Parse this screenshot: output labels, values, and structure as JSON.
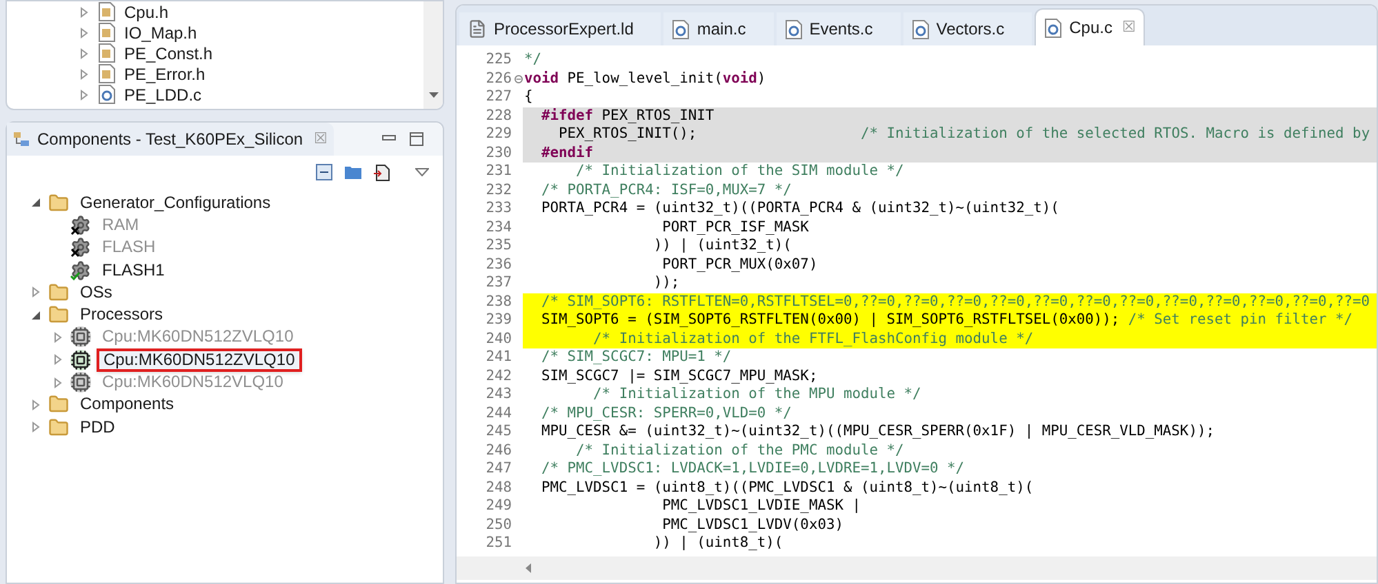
{
  "files": [
    {
      "label": "Cpu.h",
      "kind": "header",
      "expanded": false
    },
    {
      "label": "IO_Map.h",
      "kind": "header",
      "expanded": false
    },
    {
      "label": "PE_Const.h",
      "kind": "header",
      "expanded": false
    },
    {
      "label": "PE_Error.h",
      "kind": "header",
      "expanded": false
    },
    {
      "label": "PE_LDD.c",
      "kind": "source",
      "expanded": false
    }
  ],
  "components_panel": {
    "title": "Components - Test_K60PEx_Silicon",
    "close": "☒",
    "tree": [
      {
        "label": "Generator_Configurations",
        "kind": "folder",
        "expanded": true,
        "children": [
          {
            "label": "RAM",
            "kind": "component",
            "disabled": true,
            "selected": false
          },
          {
            "label": "FLASH",
            "kind": "component",
            "disabled": true,
            "selected": false
          },
          {
            "label": "FLASH1",
            "kind": "component",
            "disabled": false,
            "selected": false
          }
        ]
      },
      {
        "label": "OSs",
        "kind": "folder",
        "expanded": false
      },
      {
        "label": "Processors",
        "kind": "folder",
        "expanded": true,
        "children": [
          {
            "label": "Cpu:MK60DN512ZVLQ10",
            "kind": "cpu",
            "expanded": false,
            "disabled": true,
            "selected": false
          },
          {
            "label": "Cpu:MK60DN512ZVLQ10",
            "kind": "cpu",
            "expanded": false,
            "disabled": false,
            "selected": true
          },
          {
            "label": "Cpu:MK60DN512VLQ10",
            "kind": "cpu",
            "expanded": false,
            "disabled": true,
            "selected": false
          }
        ]
      },
      {
        "label": "Components",
        "kind": "folder",
        "expanded": false
      },
      {
        "label": "PDD",
        "kind": "folder",
        "expanded": false
      }
    ]
  },
  "editor": {
    "tabs": [
      {
        "label": "ProcessorExpert.ld",
        "kind": "text",
        "selected": false
      },
      {
        "label": "main.c",
        "kind": "source",
        "selected": false
      },
      {
        "label": "Events.c",
        "kind": "source",
        "selected": false
      },
      {
        "label": "Vectors.c",
        "kind": "source",
        "selected": false
      },
      {
        "label": "Cpu.c",
        "kind": "source",
        "selected": true
      }
    ],
    "tab_close": "☒",
    "lines": [
      {
        "number": "225",
        "kind": "plain",
        "fold_marker": false,
        "segments": [
          {
            "kind": "comment",
            "text": "*/"
          }
        ]
      },
      {
        "number": "226",
        "kind": "plain",
        "fold_marker": true,
        "segments": [
          {
            "kind": "keyword",
            "text": "void"
          },
          {
            "kind": "code",
            "text": " PE_low_level_init("
          },
          {
            "kind": "keyword",
            "text": "void"
          },
          {
            "kind": "code",
            "text": ")"
          }
        ]
      },
      {
        "number": "227",
        "kind": "plain",
        "fold_marker": false,
        "segments": [
          {
            "kind": "code",
            "text": "{"
          }
        ]
      },
      {
        "number": "228",
        "kind": "inactive",
        "fold_marker": false,
        "segments": [
          {
            "kind": "keyword",
            "text": "  #ifdef"
          },
          {
            "kind": "code",
            "text": " PEX_RTOS_INIT"
          }
        ]
      },
      {
        "number": "229",
        "kind": "inactive",
        "fold_marker": false,
        "segments": [
          {
            "kind": "code",
            "text": "    PEX_RTOS_INIT();                   "
          },
          {
            "kind": "comment",
            "text": "/* Initialization of the selected RTOS. Macro is defined by"
          }
        ]
      },
      {
        "number": "230",
        "kind": "inactive",
        "fold_marker": false,
        "segments": [
          {
            "kind": "keyword",
            "text": "  #endif"
          }
        ]
      },
      {
        "number": "231",
        "kind": "plain",
        "fold_marker": false,
        "segments": [
          {
            "kind": "comment",
            "text": "      /* Initialization of the SIM module */"
          }
        ]
      },
      {
        "number": "232",
        "kind": "plain",
        "fold_marker": false,
        "segments": [
          {
            "kind": "comment",
            "text": "  /* PORTA_PCR4: ISF=0,MUX=7 */"
          }
        ]
      },
      {
        "number": "233",
        "kind": "plain",
        "fold_marker": false,
        "segments": [
          {
            "kind": "code",
            "text": "  PORTA_PCR4 = (uint32_t)((PORTA_PCR4 & (uint32_t)~(uint32_t)("
          }
        ]
      },
      {
        "number": "234",
        "kind": "plain",
        "fold_marker": false,
        "segments": [
          {
            "kind": "code",
            "text": "                PORT_PCR_ISF_MASK"
          }
        ]
      },
      {
        "number": "235",
        "kind": "plain",
        "fold_marker": false,
        "segments": [
          {
            "kind": "code",
            "text": "               )) | (uint32_t)("
          }
        ]
      },
      {
        "number": "236",
        "kind": "plain",
        "fold_marker": false,
        "segments": [
          {
            "kind": "code",
            "text": "                PORT_PCR_MUX(0x07)"
          }
        ]
      },
      {
        "number": "237",
        "kind": "plain",
        "fold_marker": false,
        "segments": [
          {
            "kind": "code",
            "text": "               ));"
          }
        ]
      },
      {
        "number": "238",
        "kind": "marked",
        "fold_marker": false,
        "segments": [
          {
            "kind": "comment",
            "text": "  /* SIM_SOPT6: RSTFLTEN=0,RSTFLTSEL=0,??=0,??=0,??=0,??=0,??=0,??=0,??=0,??=0,??=0,??=0,??=0,??=0"
          }
        ]
      },
      {
        "number": "239",
        "kind": "marked",
        "fold_marker": false,
        "segments": [
          {
            "kind": "code",
            "text": "  SIM_SOPT6 = (SIM_SOPT6_RSTFLTEN(0x00) | SIM_SOPT6_RSTFLTSEL(0x00)); "
          },
          {
            "kind": "comment",
            "text": "/* Set reset pin filter */"
          }
        ]
      },
      {
        "number": "240",
        "kind": "marked",
        "fold_marker": false,
        "segments": [
          {
            "kind": "comment",
            "text": "        /* Initialization of the FTFL_FlashConfig module */"
          }
        ]
      },
      {
        "number": "241",
        "kind": "plain",
        "fold_marker": false,
        "segments": [
          {
            "kind": "comment",
            "text": "  /* SIM_SCGC7: MPU=1 */"
          }
        ]
      },
      {
        "number": "242",
        "kind": "plain",
        "fold_marker": false,
        "segments": [
          {
            "kind": "code",
            "text": "  SIM_SCGC7 |= SIM_SCGC7_MPU_MASK;"
          }
        ]
      },
      {
        "number": "243",
        "kind": "plain",
        "fold_marker": false,
        "segments": [
          {
            "kind": "comment",
            "text": "        /* Initialization of the MPU module */"
          }
        ]
      },
      {
        "number": "244",
        "kind": "plain",
        "fold_marker": false,
        "segments": [
          {
            "kind": "comment",
            "text": "  /* MPU_CESR: SPERR=0,VLD=0 */"
          }
        ]
      },
      {
        "number": "245",
        "kind": "plain",
        "fold_marker": false,
        "segments": [
          {
            "kind": "code",
            "text": "  MPU_CESR &= (uint32_t)~(uint32_t)((MPU_CESR_SPERR(0x1F) | MPU_CESR_VLD_MASK));"
          }
        ]
      },
      {
        "number": "246",
        "kind": "plain",
        "fold_marker": false,
        "segments": [
          {
            "kind": "comment",
            "text": "      /* Initialization of the PMC module */"
          }
        ]
      },
      {
        "number": "247",
        "kind": "plain",
        "fold_marker": false,
        "segments": [
          {
            "kind": "comment",
            "text": "  /* PMC_LVDSC1: LVDACK=1,LVDIE=0,LVDRE=1,LVDV=0 */"
          }
        ]
      },
      {
        "number": "248",
        "kind": "plain",
        "fold_marker": false,
        "segments": [
          {
            "kind": "code",
            "text": "  PMC_LVDSC1 = (uint8_t)((PMC_LVDSC1 & (uint8_t)~(uint8_t)("
          }
        ]
      },
      {
        "number": "249",
        "kind": "plain",
        "fold_marker": false,
        "segments": [
          {
            "kind": "code",
            "text": "                PMC_LVDSC1_LVDIE_MASK |"
          }
        ]
      },
      {
        "number": "250",
        "kind": "plain",
        "fold_marker": false,
        "segments": [
          {
            "kind": "code",
            "text": "                PMC_LVDSC1_LVDV(0x03)"
          }
        ]
      },
      {
        "number": "251",
        "kind": "plain",
        "fold_marker": false,
        "segments": [
          {
            "kind": "code",
            "text": "               )) | (uint8_t)("
          }
        ]
      }
    ]
  }
}
